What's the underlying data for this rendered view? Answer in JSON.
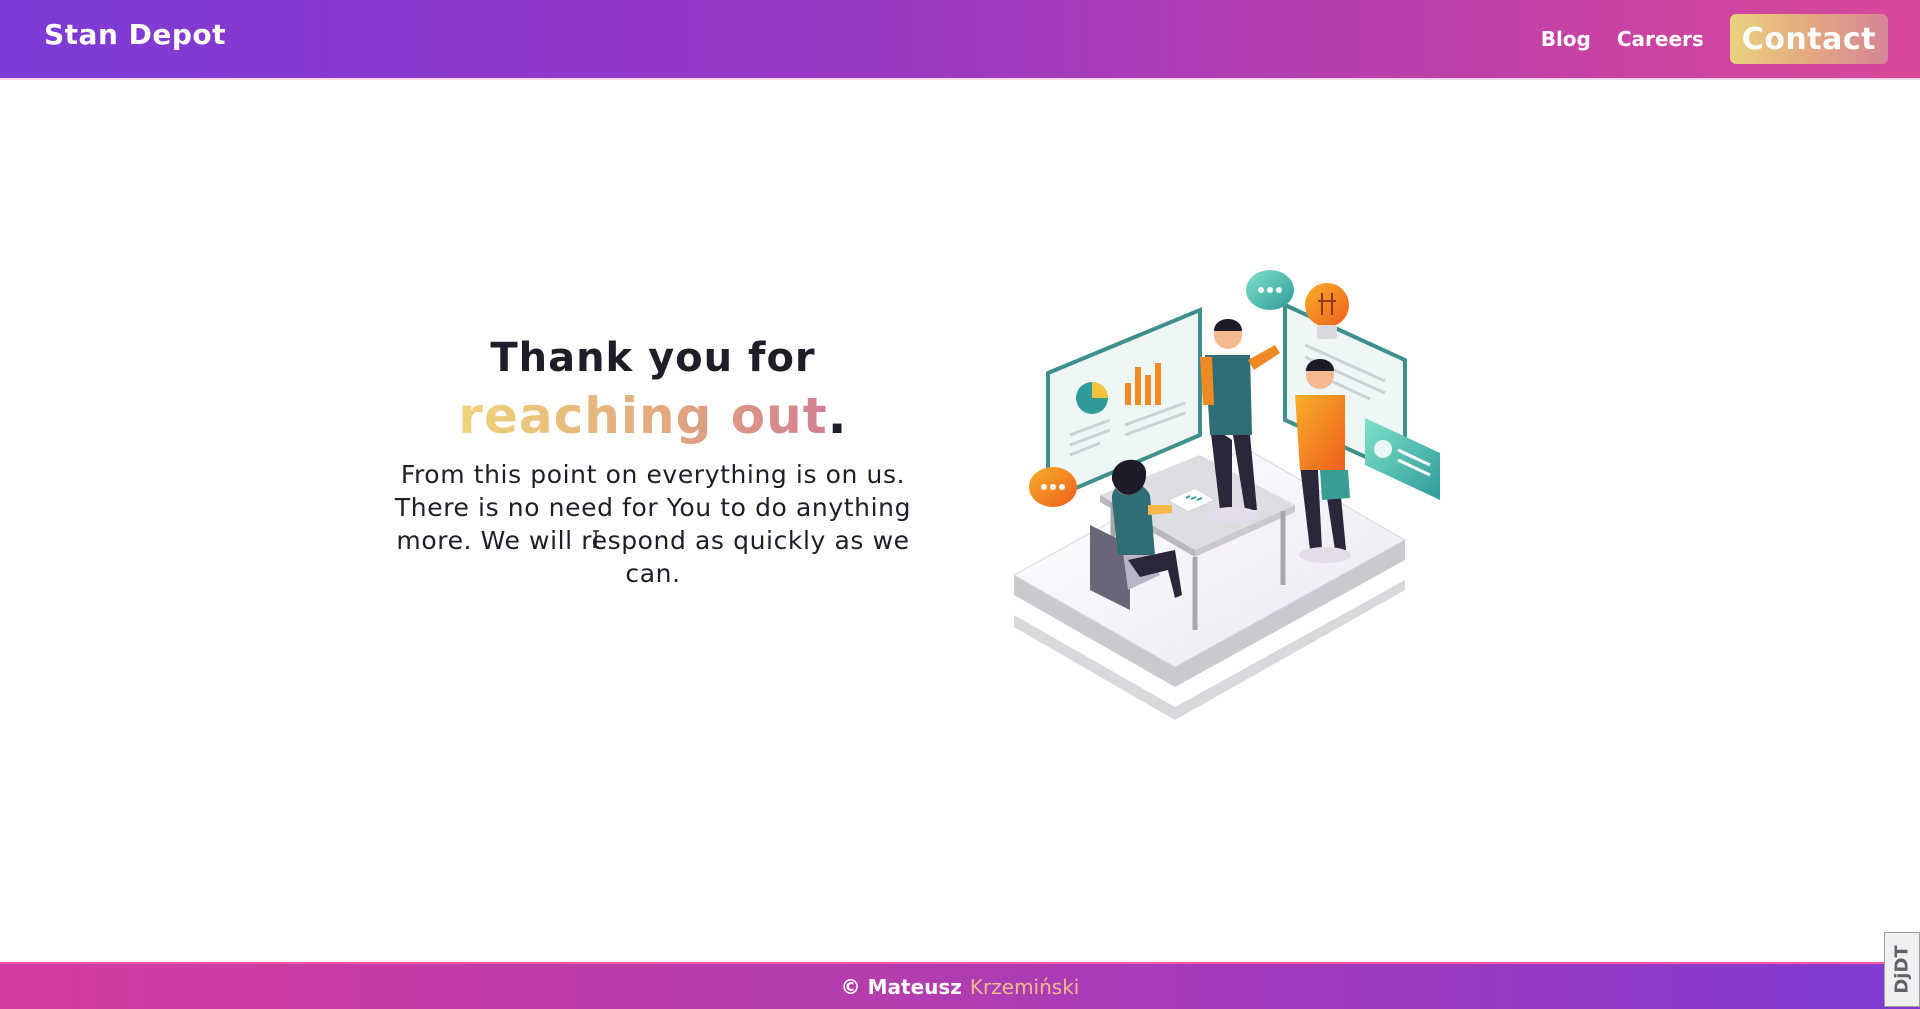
{
  "header": {
    "brand": "Stan Depot",
    "nav": [
      {
        "label": "Blog"
      },
      {
        "label": "Careers"
      }
    ],
    "contact_label": "Contact"
  },
  "main": {
    "heading_line1": "Thank you for",
    "heading_line2": "reaching out",
    "heading_punct": ".",
    "paragraph": "From this point on everything is on us. There is no need for You to do anything more. We will respond as quickly as we can."
  },
  "footer": {
    "copyright": "© Mateusz",
    "surname": "Krzemiński"
  },
  "debug_toolbar": {
    "label": "DjDT"
  },
  "colors": {
    "header_start": "#7d3ad6",
    "header_end": "#d8489b",
    "accent_gold": "#ecd27d",
    "accent_rose": "#d68597",
    "teal": "#3fb8a9",
    "orange": "#f28a1e"
  }
}
